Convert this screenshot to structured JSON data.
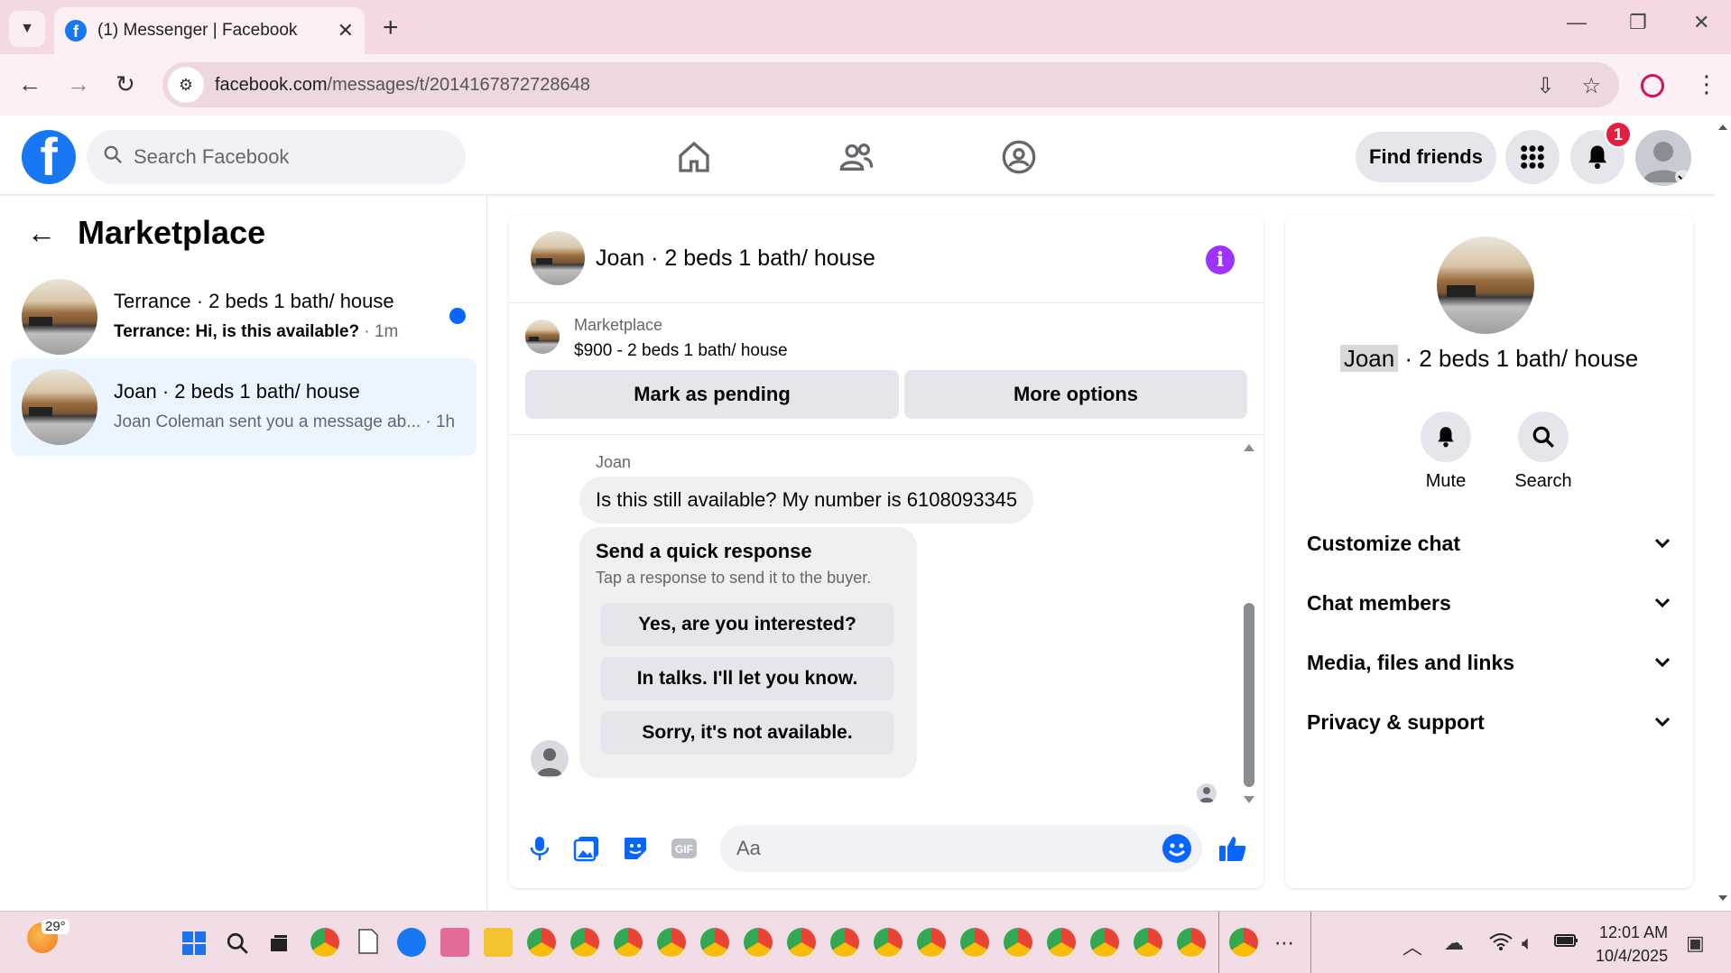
{
  "browser": {
    "tab_title": "(1) Messenger | Facebook",
    "url_host": "facebook.com",
    "url_path": "/messages/t/2014167872728648"
  },
  "fb_header": {
    "search_placeholder": "Search Facebook",
    "find_friends": "Find friends",
    "notification_count": "1"
  },
  "left_panel": {
    "title": "Marketplace",
    "conversations": [
      {
        "name": "Terrance · 2 beds 1 bath/ house",
        "preview": "Terrance: Hi, is this available?",
        "time": " · 1m",
        "unread": true
      },
      {
        "name": "Joan · 2 beds 1 bath/ house",
        "preview": "Joan Coleman sent you a message ab...",
        "time": " · 1h",
        "unread": false
      }
    ]
  },
  "chat": {
    "title": "Joan · 2 beds 1 bath/ house",
    "marketplace_label": "Marketplace",
    "listing": "$900 - 2 beds 1 bath/ house",
    "mark_pending": "Mark as pending",
    "more_options": "More options",
    "sender": "Joan",
    "message": "Is this still available? My number is 6108093345",
    "quick_title": "Send a quick response",
    "quick_subtitle": "Tap a response to send it to the buyer.",
    "quick_responses": [
      "Yes, are you interested?",
      "In talks. I'll let you know.",
      "Sorry, it's not available."
    ],
    "composer_placeholder": "Aa"
  },
  "right_panel": {
    "name_highlight": "Joan",
    "name_rest": " · 2 beds 1 bath/ house",
    "mute": "Mute",
    "search": "Search",
    "sections": [
      "Customize chat",
      "Chat members",
      "Media, files and links",
      "Privacy & support"
    ]
  },
  "taskbar": {
    "temperature": "29°",
    "time": "12:01 AM",
    "date": "10/4/2025"
  },
  "colors": {
    "fb_blue": "#1877f2",
    "messenger_blue": "#0866ff",
    "info_purple": "#a033ff",
    "unread_dot": "#0866ff",
    "badge_red": "#e41e3f"
  }
}
